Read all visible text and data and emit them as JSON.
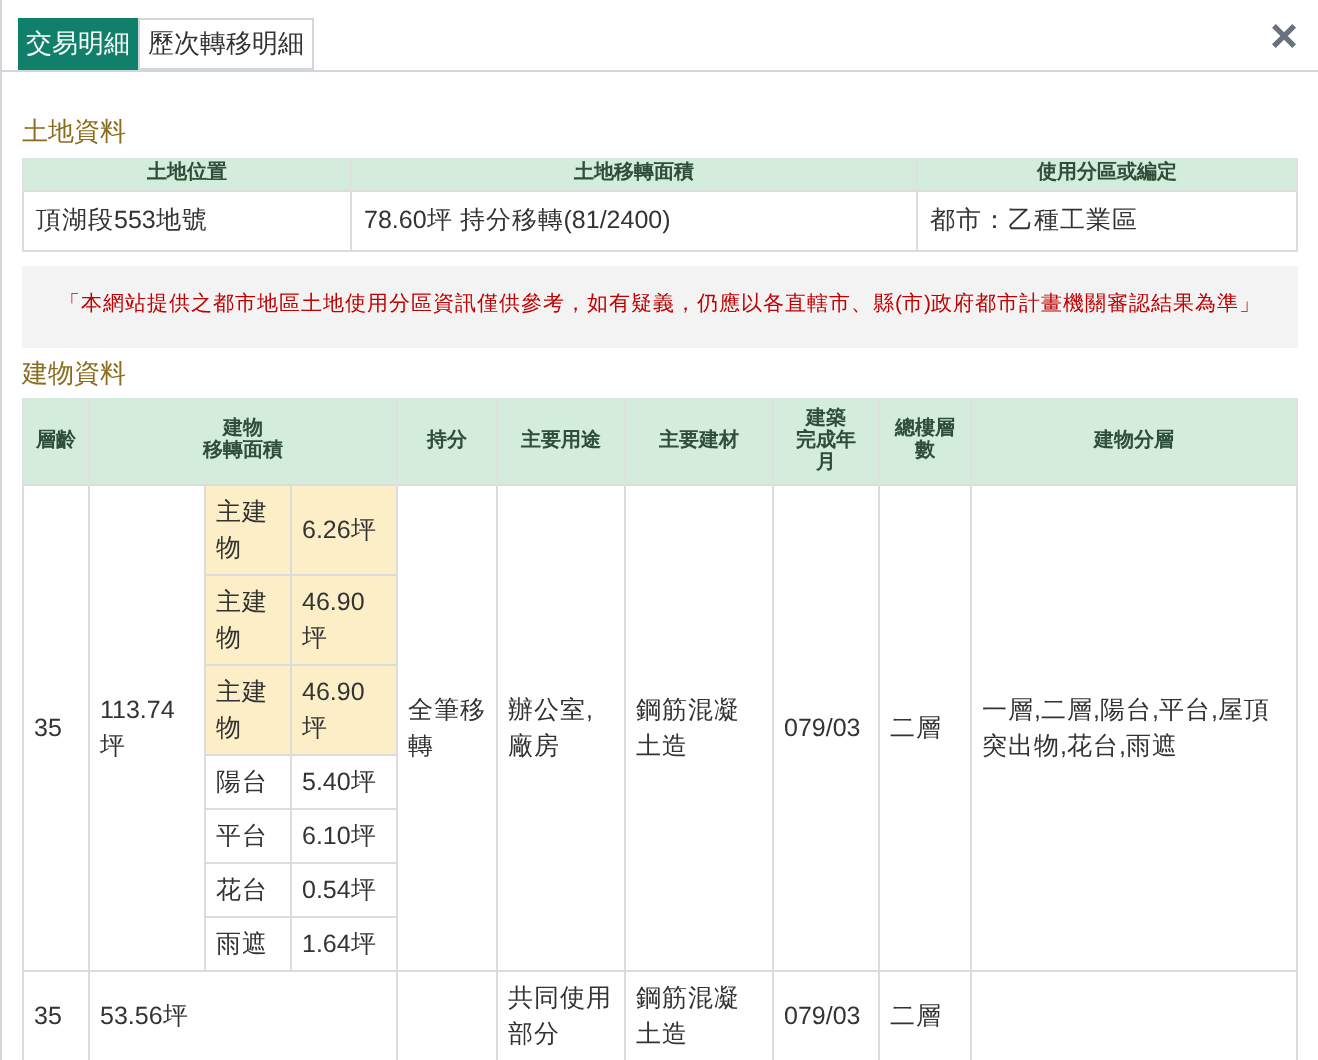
{
  "tabs": [
    {
      "label": "交易明細",
      "selected": true
    },
    {
      "label": "歷次轉移明細",
      "selected": false
    }
  ],
  "close": "×",
  "land": {
    "title": "土地資料",
    "columns": [
      "土地位置",
      "土地移轉面積",
      "使用分區或編定"
    ],
    "rows": [
      [
        "頂湖段553地號",
        "78.60坪 持分移轉(81/2400)",
        "都市：乙種工業區"
      ]
    ]
  },
  "notice": "「本網站提供之都市地區土地使用分區資訊僅供參考，如有疑義，仍應以各直轄市、縣(市)政府都市計畫機關審認結果為準」",
  "building": {
    "title": "建物資料",
    "columns": [
      [
        "層齡"
      ],
      [
        "建物",
        "移轉面積"
      ],
      [
        "持分"
      ],
      [
        "主要用途"
      ],
      [
        "主要建材"
      ],
      [
        "建築",
        "完成年",
        "月"
      ],
      [
        "總樓層",
        "數"
      ],
      [
        "建物分層"
      ]
    ],
    "rows": [
      {
        "age": "35",
        "area": "113.74坪",
        "sub_items": [
          {
            "label": "主建物",
            "value": "6.26坪",
            "highlighted": true
          },
          {
            "label": "主建物",
            "value": "46.90坪",
            "highlighted": true
          },
          {
            "label": "主建物",
            "value": "46.90坪",
            "highlighted": true
          },
          {
            "label": "陽台",
            "value": "5.40坪",
            "highlighted": false
          },
          {
            "label": "平台",
            "value": "6.10坪",
            "highlighted": false
          },
          {
            "label": "花台",
            "value": "0.54坪",
            "highlighted": false
          },
          {
            "label": "雨遮",
            "value": "1.64坪",
            "highlighted": false
          }
        ],
        "share": "全筆移轉",
        "use": "辦公室,廠房",
        "material": "鋼筋混凝土造",
        "completed": "079/03",
        "floors": "二層",
        "layers": "一層,二層,陽台,平台,屋頂突出物,花台,雨遮"
      },
      {
        "age": "35",
        "area": "53.56坪",
        "sub_items": [],
        "share": "",
        "use": "共同使用部分",
        "material": "鋼筋混凝土造",
        "completed": "079/03",
        "floors": "二層",
        "layers": ""
      }
    ]
  }
}
